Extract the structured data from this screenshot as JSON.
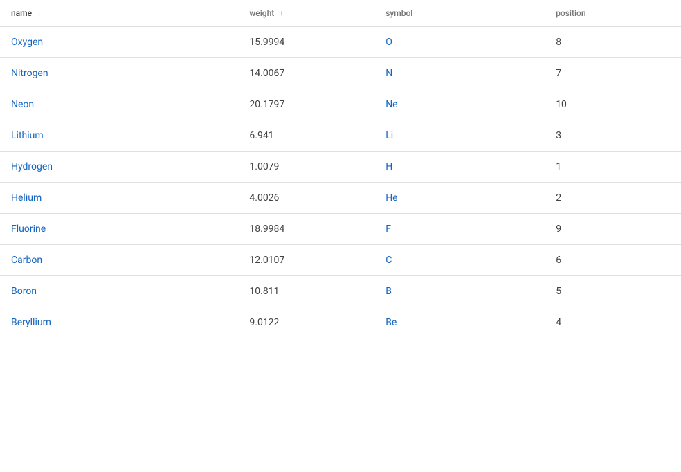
{
  "table": {
    "columns": [
      {
        "id": "name",
        "label": "name",
        "sortDir": "desc",
        "sortable": true
      },
      {
        "id": "weight",
        "label": "weight",
        "sortDir": "asc",
        "sortable": true,
        "active": true
      },
      {
        "id": "symbol",
        "label": "symbol",
        "sortable": false
      },
      {
        "id": "position",
        "label": "position",
        "sortable": false
      }
    ],
    "rows": [
      {
        "name": "Oxygen",
        "weight": "15.9994",
        "symbol": "O",
        "position": "8"
      },
      {
        "name": "Nitrogen",
        "weight": "14.0067",
        "symbol": "N",
        "position": "7"
      },
      {
        "name": "Neon",
        "weight": "20.1797",
        "symbol": "Ne",
        "position": "10"
      },
      {
        "name": "Lithium",
        "weight": "6.941",
        "symbol": "Li",
        "position": "3"
      },
      {
        "name": "Hydrogen",
        "weight": "1.0079",
        "symbol": "H",
        "position": "1"
      },
      {
        "name": "Helium",
        "weight": "4.0026",
        "symbol": "He",
        "position": "2"
      },
      {
        "name": "Fluorine",
        "weight": "18.9984",
        "symbol": "F",
        "position": "9"
      },
      {
        "name": "Carbon",
        "weight": "12.0107",
        "symbol": "C",
        "position": "6"
      },
      {
        "name": "Boron",
        "weight": "10.811",
        "symbol": "B",
        "position": "5"
      },
      {
        "name": "Beryllium",
        "weight": "9.0122",
        "symbol": "Be",
        "position": "4"
      }
    ]
  }
}
